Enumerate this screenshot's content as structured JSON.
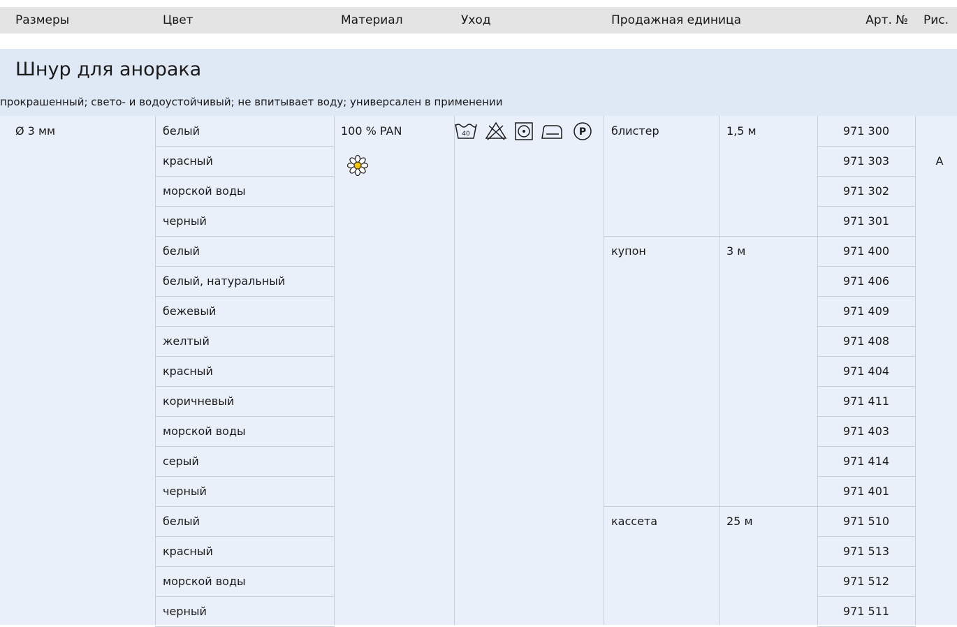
{
  "header": {
    "sizes": "Размеры",
    "color": "Цвет",
    "material": "Материал",
    "care": "Уход",
    "sales_unit": "Продажная единица",
    "art_no": "Арт. №",
    "fig": "Рис."
  },
  "product": {
    "title": "Шнур для анорака",
    "description": "прокрашенный; свето- и водоустойчивый; не впитывает воду; универсален в применении",
    "size": "Ø 3 мм",
    "material": "100 % PAN",
    "fig": "A",
    "care_icons": [
      "wash-40-icon",
      "no-bleach-icon",
      "tumble-dry-icon",
      "iron-icon",
      "dry-clean-p-icon"
    ],
    "material_icon": "flower-icon",
    "accent_color": "#f5c400"
  },
  "rows": [
    {
      "color": "белый",
      "unit": "блистер",
      "length": "1,5 м",
      "art": "971 300"
    },
    {
      "color": "красный",
      "unit": "",
      "length": "",
      "art": "971 303"
    },
    {
      "color": "морской воды",
      "unit": "",
      "length": "",
      "art": "971 302"
    },
    {
      "color": "черный",
      "unit": "",
      "length": "",
      "art": "971 301"
    },
    {
      "color": "белый",
      "unit": "купон",
      "length": "3 м",
      "art": "971 400"
    },
    {
      "color": "белый, натуральный",
      "unit": "",
      "length": "",
      "art": "971 406"
    },
    {
      "color": "бежевый",
      "unit": "",
      "length": "",
      "art": "971 409"
    },
    {
      "color": "желтый",
      "unit": "",
      "length": "",
      "art": "971 408"
    },
    {
      "color": "красный",
      "unit": "",
      "length": "",
      "art": "971 404"
    },
    {
      "color": "коричневый",
      "unit": "",
      "length": "",
      "art": "971 411"
    },
    {
      "color": "морской воды",
      "unit": "",
      "length": "",
      "art": "971 403"
    },
    {
      "color": "серый",
      "unit": "",
      "length": "",
      "art": "971 414"
    },
    {
      "color": "черный",
      "unit": "",
      "length": "",
      "art": "971 401"
    },
    {
      "color": "белый",
      "unit": "кассета",
      "length": "25 м",
      "art": "971 510"
    },
    {
      "color": "красный",
      "unit": "",
      "length": "",
      "art": "971 513"
    },
    {
      "color": "морской воды",
      "unit": "",
      "length": "",
      "art": "971 512"
    },
    {
      "color": "черный",
      "unit": "",
      "length": "",
      "art": "971 511"
    }
  ]
}
